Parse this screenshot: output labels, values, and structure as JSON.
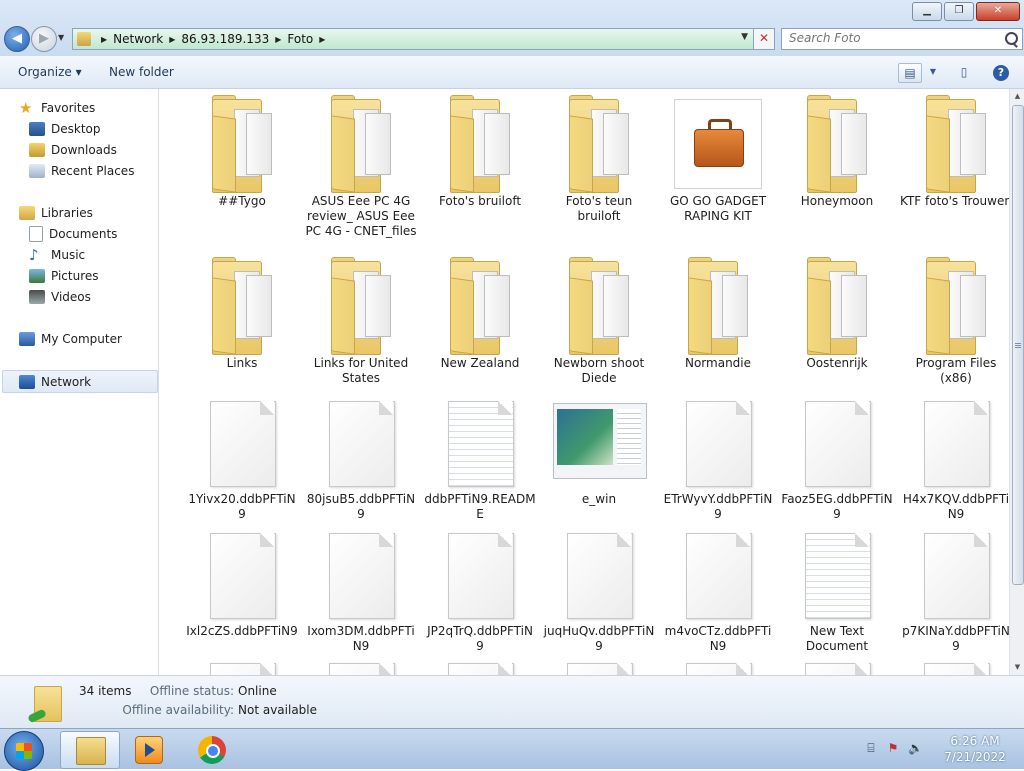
{
  "window": {
    "minimize_label": "▁",
    "maximize_label": "❐",
    "close_label": "✕"
  },
  "address_bar": {
    "breadcrumbs": [
      "Network",
      "86.93.189.133",
      "Foto"
    ]
  },
  "search": {
    "placeholder": "Search Foto"
  },
  "toolbar": {
    "organize_label": "Organize ▾",
    "new_folder_label": "New folder",
    "help_label": "?"
  },
  "sidebar": {
    "favorites": "Favorites",
    "desktop": "Desktop",
    "downloads": "Downloads",
    "recent_places": "Recent Places",
    "libraries": "Libraries",
    "documents": "Documents",
    "music": "Music",
    "pictures": "Pictures",
    "videos": "Videos",
    "my_computer": "My Computer",
    "network": "Network"
  },
  "items": [
    {
      "name": "##Tygo",
      "type": "folder"
    },
    {
      "name": "ASUS Eee PC 4G review_ ASUS Eee PC 4G - CNET_files",
      "type": "folder"
    },
    {
      "name": "Foto's bruiloft",
      "type": "folder"
    },
    {
      "name": "Foto's teun bruiloft",
      "type": "folder"
    },
    {
      "name": "GO GO GADGET RAPING KIT",
      "type": "briefcase"
    },
    {
      "name": "Honeymoon",
      "type": "folder"
    },
    {
      "name": "KTF foto's Trouwen",
      "type": "folder"
    },
    {
      "name": "Links",
      "type": "folder"
    },
    {
      "name": "Links for United States",
      "type": "folder"
    },
    {
      "name": "New Zealand",
      "type": "folder"
    },
    {
      "name": "Newborn shoot Diede",
      "type": "folder"
    },
    {
      "name": "Normandie",
      "type": "folder"
    },
    {
      "name": "Oostenrijk",
      "type": "folder"
    },
    {
      "name": "Program Files (x86)",
      "type": "folder"
    },
    {
      "name": "1Yivx20.ddbPFTiN9",
      "type": "file"
    },
    {
      "name": "80jsuB5.ddbPFTiN9",
      "type": "file"
    },
    {
      "name": "ddbPFTiN9.README",
      "type": "file-lined"
    },
    {
      "name": "e_win",
      "type": "thumbnail"
    },
    {
      "name": "ETrWyvY.ddbPFTiN9",
      "type": "file"
    },
    {
      "name": "Faoz5EG.ddbPFTiN9",
      "type": "file"
    },
    {
      "name": "H4x7KQV.ddbPFTiN9",
      "type": "file"
    },
    {
      "name": "Ixl2cZS.ddbPFTiN9",
      "type": "file"
    },
    {
      "name": "Ixom3DM.ddbPFTiN9",
      "type": "file"
    },
    {
      "name": "JP2qTrQ.ddbPFTiN9",
      "type": "file"
    },
    {
      "name": "juqHuQv.ddbPFTiN9",
      "type": "file"
    },
    {
      "name": "m4voCTz.ddbPFTiN9",
      "type": "file"
    },
    {
      "name": "New Text Document",
      "type": "file-lined"
    },
    {
      "name": "p7KINaY.ddbPFTiN9",
      "type": "file"
    }
  ],
  "details": {
    "count": "34 items",
    "offline_status_label": "Offline status:",
    "offline_status_value": "Online",
    "offline_availability_label": "Offline availability:",
    "offline_availability_value": "Not available"
  },
  "taskbar": {
    "time": "6:26 AM",
    "date": "7/21/2022"
  }
}
